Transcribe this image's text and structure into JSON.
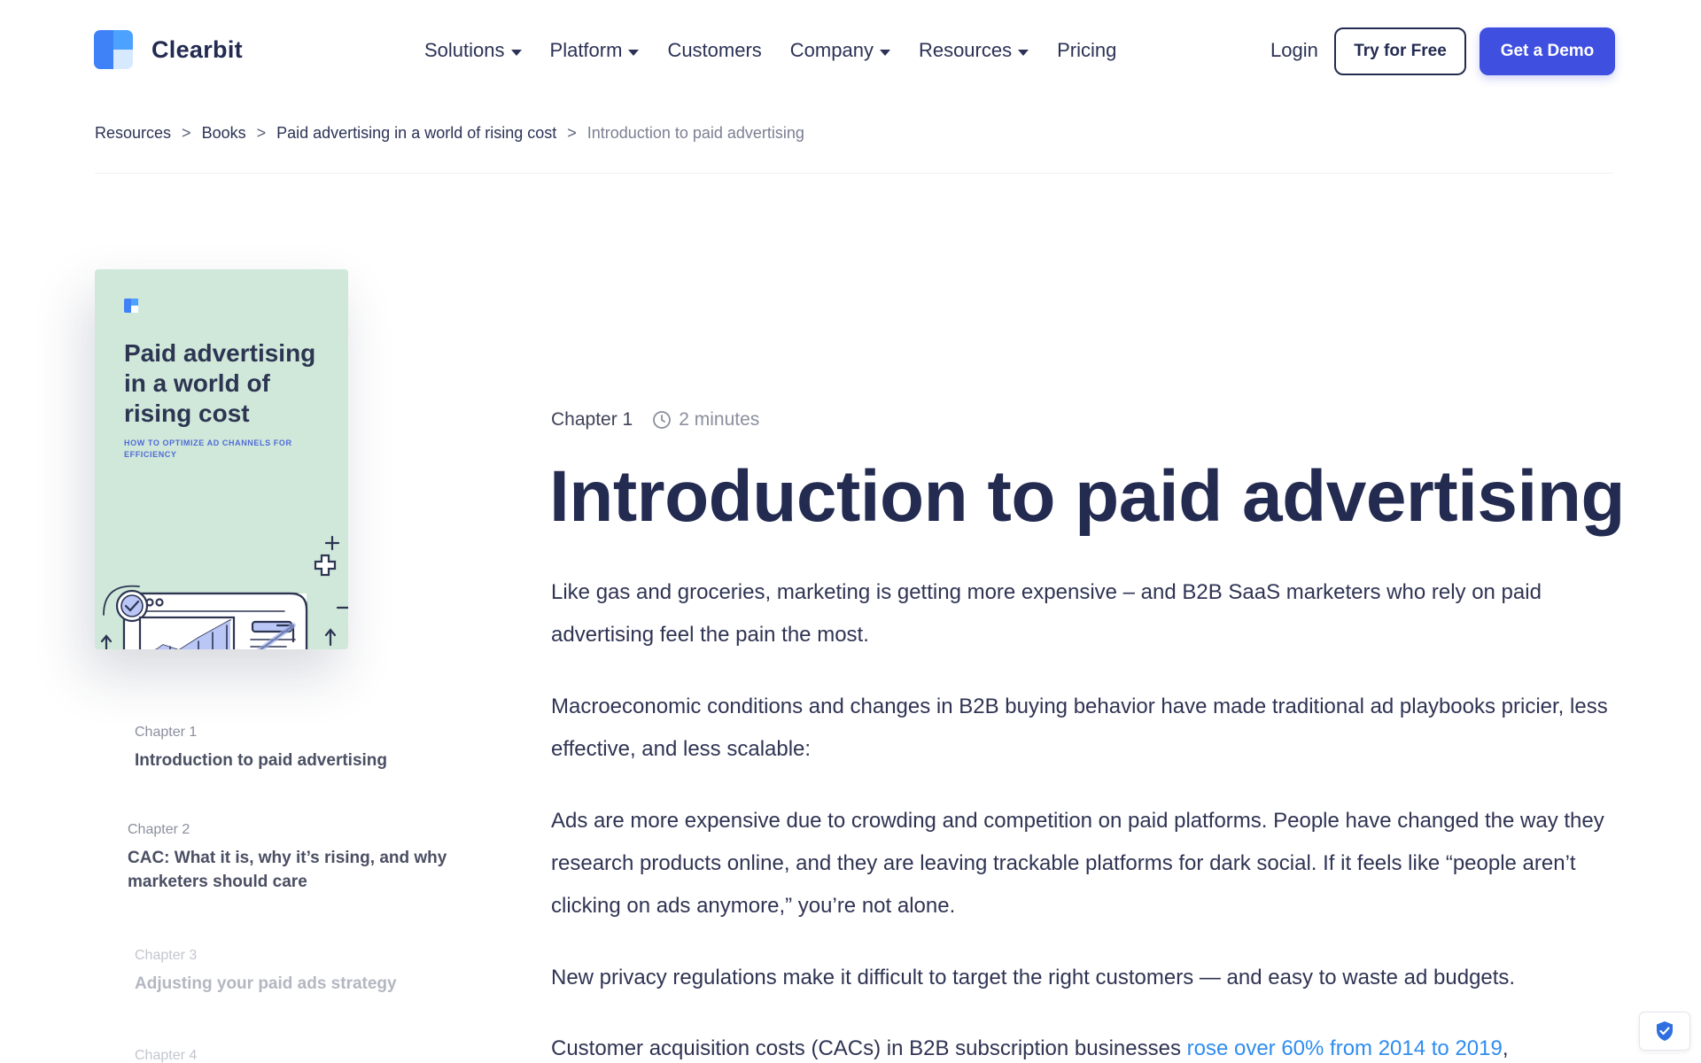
{
  "header": {
    "logo_text": "Clearbit",
    "nav": [
      {
        "label": "Solutions",
        "dropdown": true
      },
      {
        "label": "Platform",
        "dropdown": true
      },
      {
        "label": "Customers",
        "dropdown": false
      },
      {
        "label": "Company",
        "dropdown": true
      },
      {
        "label": "Resources",
        "dropdown": true
      },
      {
        "label": "Pricing",
        "dropdown": false
      }
    ],
    "login": "Login",
    "try_free": "Try for Free",
    "get_demo": "Get a Demo"
  },
  "breadcrumb": {
    "items": [
      "Resources",
      "Books",
      "Paid advertising in a world of rising cost"
    ],
    "current": "Introduction to paid advertising",
    "separator": ">"
  },
  "cover": {
    "title": "Paid advertising in a world of rising cost",
    "subtitle": "HOW TO OPTIMIZE AD CHANNELS FOR EFFICIENCY"
  },
  "chapters": [
    {
      "num": "Chapter 1",
      "title": "Introduction to paid advertising"
    },
    {
      "num": "Chapter 2",
      "title": "CAC: What it is, why it’s rising, and why marketers should care"
    },
    {
      "num": "Chapter 3",
      "title": "Adjusting your paid ads strategy"
    },
    {
      "num": "Chapter 4",
      "title": ""
    }
  ],
  "article": {
    "chapter": "Chapter 1",
    "read_time": "2 minutes",
    "title": "Introduction to paid advertising",
    "paragraphs": [
      "Like gas and groceries, marketing is getting more expensive – and B2B SaaS marketers who rely on paid advertising feel the pain the most.",
      "Macroeconomic conditions and changes in B2B buying behavior have made traditional ad playbooks pricier, less effective, and less scalable:",
      "Ads are more expensive due to crowding and competition on paid platforms. People have changed the way they research products online, and they are leaving trackable platforms for dark social. If it feels like “people aren’t clicking on ads anymore,” you’re not alone.",
      "New privacy regulations make it difficult to target the right customers — and easy to waste ad budgets."
    ],
    "last_para_prefix": "Customer acquisition costs (CACs) in B2B subscription businesses ",
    "last_para_link": "rose over 60% from 2014 to 2019",
    "last_para_suffix": ","
  },
  "colors": {
    "brand_navy": "#232b51",
    "accent_blue": "#3f4fe0",
    "link_blue": "#2f8df0",
    "cover_green": "#cfe8d9"
  }
}
